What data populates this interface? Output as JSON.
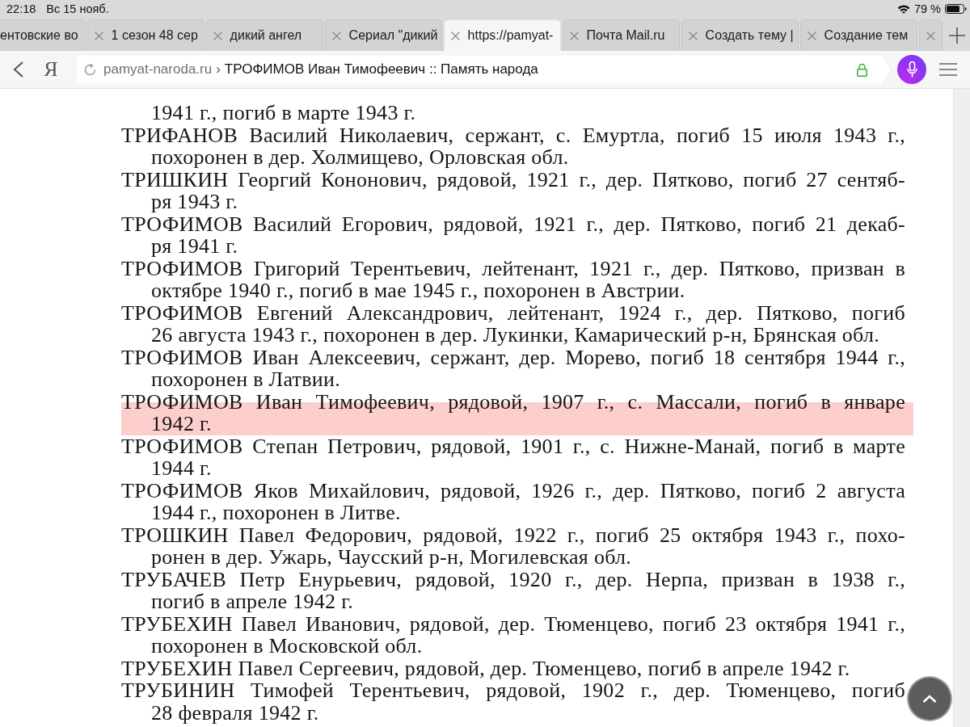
{
  "status_bar": {
    "time": "22:18",
    "date": "Вс 15 нояб.",
    "battery": "79 %"
  },
  "tabs": [
    {
      "label": "ентовские во",
      "closable": false,
      "selected": false
    },
    {
      "label": "1 сезон 48 сер",
      "closable": true,
      "selected": false
    },
    {
      "label": "дикий ангел",
      "closable": true,
      "selected": false
    },
    {
      "label": "Сериал \"дикий",
      "closable": true,
      "selected": false
    },
    {
      "label": "https://pamyat-",
      "closable": true,
      "selected": true
    },
    {
      "label": "Почта Mail.ru",
      "closable": true,
      "selected": false
    },
    {
      "label": "Создать тему |",
      "closable": true,
      "selected": false
    },
    {
      "label": "Создание тем",
      "closable": true,
      "selected": false
    },
    {
      "closable": true,
      "selected": false
    }
  ],
  "toolbar": {
    "logo": "Я",
    "address": {
      "domain": "pamyat-naroda.ru",
      "separator": "›",
      "title": "ТРОФИМОВ Иван Тимофеевич :: Память народа",
      "secure": true
    }
  },
  "document": {
    "entries": [
      {
        "kind": "continuation",
        "highlighted": false,
        "lines": [
          "1941 г., погиб в марте 1943 г."
        ]
      },
      {
        "kind": "entry",
        "highlighted": false,
        "lines": [
          "ТРИФАНОВ Василий Николаевич, сержант, с. Емуртла, погиб 15 июля 1943 г.,",
          "похоронен в дер. Холмищево, Орловская обл."
        ]
      },
      {
        "kind": "entry",
        "highlighted": false,
        "lines": [
          "ТРИШКИН Георгий Кононович, рядовой, 1921 г., дер. Пятково, погиб 27 сентяб-",
          "ря 1943 г."
        ]
      },
      {
        "kind": "entry",
        "highlighted": false,
        "lines": [
          "ТРОФИМОВ Василий Егорович, рядовой, 1921 г., дер. Пятково, погиб 21 декаб-",
          "ря 1941 г."
        ]
      },
      {
        "kind": "entry",
        "highlighted": false,
        "lines": [
          "ТРОФИМОВ Григорий Терентьевич, лейтенант, 1921 г., дер. Пятково, призван в",
          "октябре 1940 г., погиб в мае 1945 г., похоронен в Австрии."
        ]
      },
      {
        "kind": "entry",
        "highlighted": false,
        "lines": [
          "ТРОФИМОВ Евгений Александрович, лейтенант, 1924 г., дер. Пятково, погиб",
          "26 августа 1943 г., похоронен в дер. Лукинки, Камарический р-н, Брянская обл."
        ]
      },
      {
        "kind": "entry",
        "highlighted": false,
        "lines": [
          "ТРОФИМОВ Иван Алексеевич, сержант, дер. Морево, погиб 18 сентября 1944 г.,",
          "похоронен в Латвии."
        ]
      },
      {
        "kind": "entry",
        "highlighted": true,
        "lines": [
          "ТРОФИМОВ Иван Тимофеевич, рядовой, 1907 г., с. Массали, погиб в январе",
          "1942 г."
        ]
      },
      {
        "kind": "entry",
        "highlighted": false,
        "lines": [
          "ТРОФИМОВ Степан Петрович, рядовой, 1901 г., с. Нижне-Манай, погиб в марте",
          "1944 г."
        ]
      },
      {
        "kind": "entry",
        "highlighted": false,
        "lines": [
          "ТРОФИМОВ Яков Михайлович, рядовой, 1926 г., дер. Пятково, погиб 2 августа",
          "1944 г., похоронен в Литве."
        ]
      },
      {
        "kind": "entry",
        "highlighted": false,
        "lines": [
          "ТРОШКИН Павел Федорович, рядовой, 1922 г., погиб 25 октября 1943 г., похо-",
          "ронен в дер. Ужарь, Чаусский р-н, Могилевская обл."
        ]
      },
      {
        "kind": "entry",
        "highlighted": false,
        "lines": [
          "ТРУБАЧЕВ Петр Енурьевич, рядовой, 1920 г., дер. Нерпа, призван в 1938 г.,",
          "погиб в апреле 1942 г."
        ]
      },
      {
        "kind": "entry",
        "highlighted": false,
        "lines": [
          "ТРУБЕХИН Павел Иванович, рядовой, дер. Тюменцево, погиб 23 октября 1941 г.,",
          "похоронен в Московской обл."
        ]
      },
      {
        "kind": "entry",
        "highlighted": false,
        "lines": [
          "ТРУБЕХИН Павел Сергеевич, рядовой, дер. Тюменцево, погиб в апреле 1942 г."
        ]
      },
      {
        "kind": "entry",
        "highlighted": false,
        "lines": [
          "ТРУБИНИН Тимофей Терентьевич, рядовой, 1902 г., дер. Тюменцево, погиб",
          "28 февраля 1942 г."
        ]
      }
    ]
  }
}
